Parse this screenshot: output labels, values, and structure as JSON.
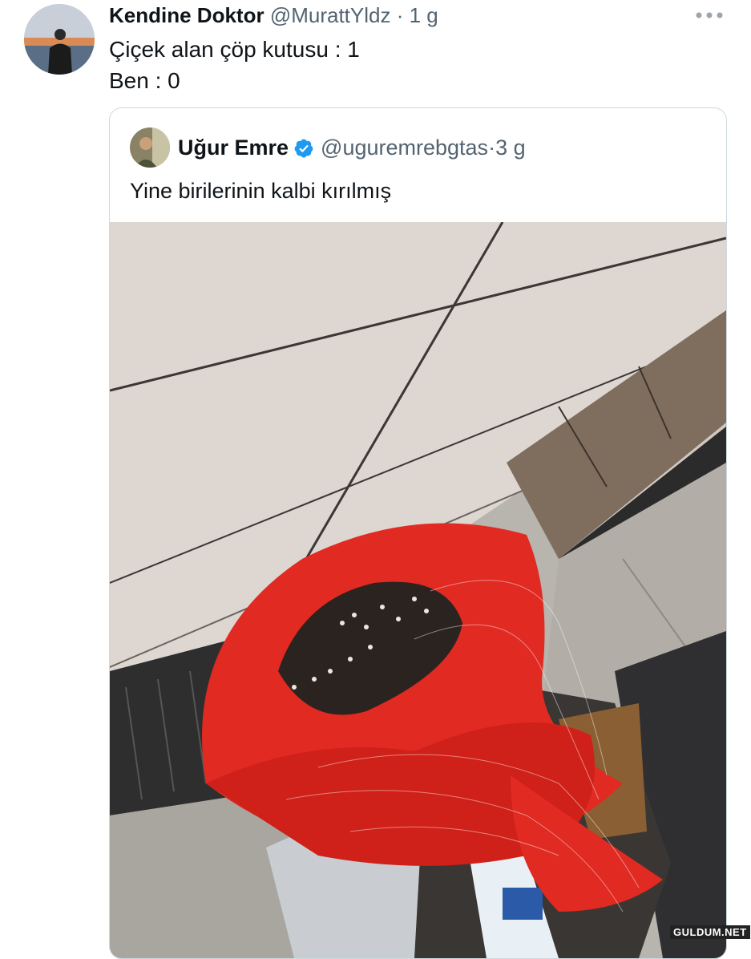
{
  "tweet": {
    "author_name": "Kendine Doktor",
    "author_handle": "@MurattYldz",
    "separator": "·",
    "time": "1 g",
    "line1": "Çiçek alan çöp kutusu : 1",
    "line2": "Ben : 0"
  },
  "quoted": {
    "author_name": "Uğur Emre",
    "author_handle": "@uguremrebgtas",
    "separator": "·",
    "time": "3 g",
    "text": "Yine birilerinin kalbi kırılmış"
  },
  "icons": {
    "more": "more-horizontal-icon",
    "verified": "verified-badge-icon"
  },
  "colors": {
    "verified_blue": "#1d9bf0",
    "handle_gray": "#536471",
    "border": "#cfd9de",
    "bouquet_red": "#e02a22"
  },
  "watermark": "GULDUM.NET"
}
